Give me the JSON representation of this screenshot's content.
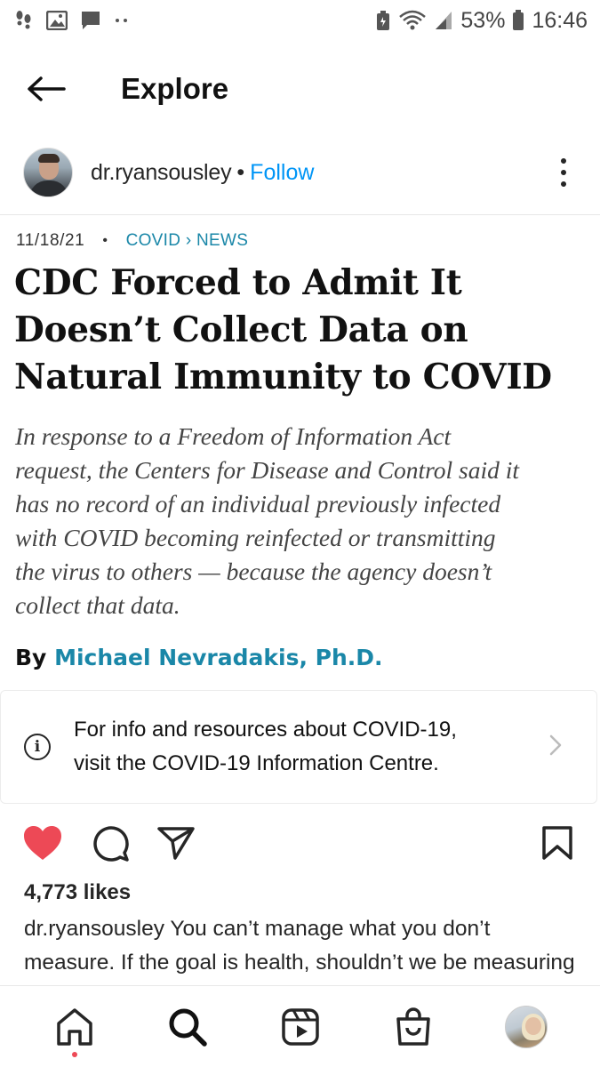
{
  "status_bar": {
    "battery": "53%",
    "time": "16:46",
    "left_icons": [
      "footsteps-icon",
      "gallery-icon",
      "message-icon",
      "more-notifications-icon"
    ],
    "right_icons": [
      "battery-saver-icon",
      "wifi-icon",
      "signal-icon",
      "battery-icon"
    ]
  },
  "header": {
    "title": "Explore",
    "back_icon": "arrow-left-icon"
  },
  "post": {
    "username": "dr.ryansousley",
    "separator": "•",
    "follow_label": "Follow",
    "more_icon": "more-vertical-icon"
  },
  "article": {
    "date": "11/18/21",
    "bullet": "•",
    "category": "COVID › NEWS",
    "headline_lines": [
      "CDC Forced to Admit It",
      "Doesn’t Collect Data on",
      "Natural Immunity to COVID"
    ],
    "summary_lines": [
      "In response to a Freedom of Information Act",
      "request, the Centers for Disease and Control said it",
      "has no record of an individual previously infected",
      "with COVID becoming reinfected or transmitting",
      "the virus to others — because the agency doesn’t",
      "collect that data."
    ],
    "byline_prefix": "By",
    "author": "Michael Nevradakis, Ph.D."
  },
  "info_banner": {
    "line1": "For info and resources about COVID-19,",
    "line2": "visit the COVID-19 Information Centre.",
    "icon": "info-icon",
    "chevron_icon": "chevron-right-icon"
  },
  "actions": {
    "like_icon": "heart-filled-icon",
    "comment_icon": "comment-icon",
    "share_icon": "send-icon",
    "save_icon": "bookmark-icon",
    "like_color": "#ed4956"
  },
  "likes": "4,773 likes",
  "caption": {
    "username": "dr.ryansousley",
    "text": " You can’t manage what you don’t measure. If the goal is health, shouldn’t we be measuring it?"
  },
  "bottom_nav": {
    "items": [
      "home-icon",
      "search-icon",
      "reels-icon",
      "shop-icon",
      "profile-avatar"
    ]
  },
  "colors": {
    "accent_blue": "#0095f6",
    "article_teal": "#1a87a8",
    "like_red": "#ed4956"
  }
}
